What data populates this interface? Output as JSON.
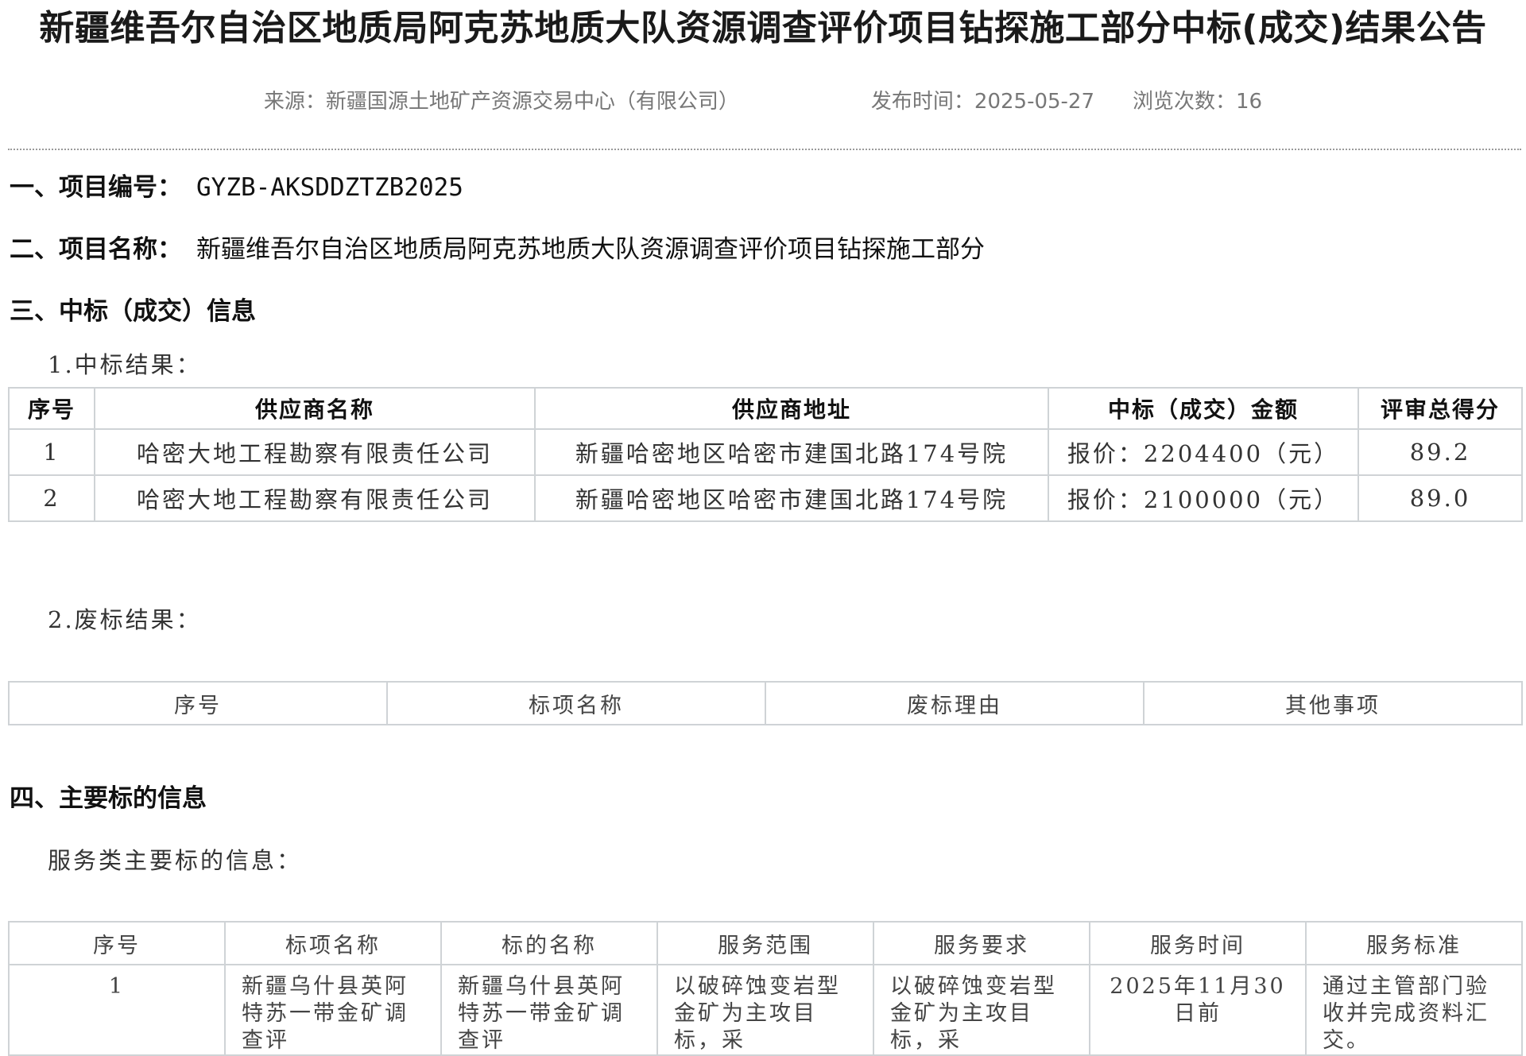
{
  "header": {
    "title": "新疆维吾尔自治区地质局阿克苏地质大队资源调查评价项目钻探施工部分中标(成交)结果公告",
    "source": "来源：新疆国源土地矿产资源交易中心（有限公司）",
    "publish_time": "发布时间：2025-05-27",
    "views": "浏览次数：16"
  },
  "section1": {
    "heading": "一、项目编号：",
    "value": "GYZB-AKSDDZTZB2025"
  },
  "section2": {
    "heading": "二、项目名称：",
    "value": "新疆维吾尔自治区地质局阿克苏地质大队资源调查评价项目钻探施工部分"
  },
  "section3": {
    "heading": "三、中标（成交）信息",
    "sub1": "1.中标结果：",
    "result_table": {
      "headers": [
        "序号",
        "供应商名称",
        "供应商地址",
        "中标（成交）金额",
        "评审总得分"
      ],
      "rows": [
        [
          "1",
          "哈密大地工程勘察有限责任公司",
          "新疆哈密地区哈密市建国北路174号院",
          "报价：2204400（元）",
          "89.2"
        ],
        [
          "2",
          "哈密大地工程勘察有限责任公司",
          "新疆哈密地区哈密市建国北路174号院",
          "报价：2100000（元）",
          "89.0"
        ]
      ]
    },
    "sub2": "2.废标结果：",
    "void_table": {
      "headers": [
        "序号",
        "标项名称",
        "废标理由",
        "其他事项"
      ]
    }
  },
  "section4": {
    "heading": "四、主要标的信息",
    "sub": "服务类主要标的信息：",
    "table": {
      "headers": [
        "序号",
        "标项名称",
        "标的名称",
        "服务范围",
        "服务要求",
        "服务时间",
        "服务标准"
      ],
      "row": [
        "1",
        "新疆乌什县英阿特苏一带金矿调查评",
        "新疆乌什县英阿特苏一带金矿调查评",
        "以破碎蚀变岩型金矿为主攻目标，采",
        "以破碎蚀变岩型金矿为主攻目标，采",
        "2025年11月30日前",
        "通过主管部门验收并完成资料汇交。"
      ]
    }
  }
}
